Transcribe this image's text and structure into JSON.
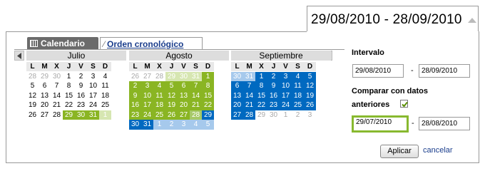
{
  "range_display": "29/08/2010 - 28/09/2010",
  "tabs": {
    "calendar": "Calendario",
    "chronological": "Orden cronológico"
  },
  "weekdays": [
    "L",
    "M",
    "X",
    "J",
    "V",
    "S",
    "D"
  ],
  "months": [
    {
      "name": "Julio",
      "weeks": [
        [
          [
            "28",
            "pale"
          ],
          [
            "29",
            "pale"
          ],
          [
            "30",
            "pale"
          ],
          [
            "1",
            "dflt"
          ],
          [
            "2",
            "dflt"
          ],
          [
            "3",
            "dflt"
          ],
          [
            "4",
            "dflt"
          ]
        ],
        [
          [
            "5",
            "dflt"
          ],
          [
            "6",
            "dflt"
          ],
          [
            "7",
            "dflt"
          ],
          [
            "8",
            "dflt"
          ],
          [
            "9",
            "dflt"
          ],
          [
            "10",
            "dflt"
          ],
          [
            "11",
            "dflt"
          ]
        ],
        [
          [
            "12",
            "dflt"
          ],
          [
            "13",
            "dflt"
          ],
          [
            "14",
            "dflt"
          ],
          [
            "15",
            "dflt"
          ],
          [
            "16",
            "dflt"
          ],
          [
            "17",
            "dflt"
          ],
          [
            "18",
            "dflt"
          ]
        ],
        [
          [
            "19",
            "dflt"
          ],
          [
            "20",
            "dflt"
          ],
          [
            "21",
            "dflt"
          ],
          [
            "22",
            "dflt"
          ],
          [
            "23",
            "dflt"
          ],
          [
            "24",
            "dflt"
          ],
          [
            "25",
            "dflt"
          ]
        ],
        [
          [
            "26",
            "dflt"
          ],
          [
            "27",
            "dflt"
          ],
          [
            "28",
            "dflt"
          ],
          [
            "29",
            "cmp"
          ],
          [
            "30",
            "cmp"
          ],
          [
            "31",
            "cmp"
          ],
          [
            "1",
            "cmplight"
          ]
        ]
      ]
    },
    {
      "name": "Agosto",
      "weeks": [
        [
          [
            "26",
            "pale"
          ],
          [
            "27",
            "pale"
          ],
          [
            "28",
            "pale"
          ],
          [
            "29",
            "cmplight"
          ],
          [
            "30",
            "cmplight"
          ],
          [
            "31",
            "cmplight"
          ],
          [
            "1",
            "cmp"
          ]
        ],
        [
          [
            "2",
            "cmp"
          ],
          [
            "3",
            "cmp"
          ],
          [
            "4",
            "cmp"
          ],
          [
            "5",
            "cmp"
          ],
          [
            "6",
            "cmp"
          ],
          [
            "7",
            "cmp"
          ],
          [
            "8",
            "cmp"
          ]
        ],
        [
          [
            "9",
            "cmp"
          ],
          [
            "10",
            "cmp"
          ],
          [
            "11",
            "cmp"
          ],
          [
            "12",
            "cmp"
          ],
          [
            "13",
            "cmp"
          ],
          [
            "14",
            "cmp"
          ],
          [
            "15",
            "cmp"
          ]
        ],
        [
          [
            "16",
            "cmp"
          ],
          [
            "17",
            "cmp"
          ],
          [
            "18",
            "cmp"
          ],
          [
            "19",
            "cmp"
          ],
          [
            "20",
            "cmp"
          ],
          [
            "21",
            "cmp"
          ],
          [
            "22",
            "cmp"
          ]
        ],
        [
          [
            "23",
            "cmp"
          ],
          [
            "24",
            "cmp"
          ],
          [
            "25",
            "cmp"
          ],
          [
            "26",
            "cmp"
          ],
          [
            "27",
            "cmp"
          ],
          [
            "28",
            "both"
          ],
          [
            "29",
            "cur"
          ]
        ],
        [
          [
            "30",
            "cur"
          ],
          [
            "31",
            "cur"
          ],
          [
            "1",
            "curlight"
          ],
          [
            "2",
            "curlight"
          ],
          [
            "3",
            "curlight"
          ],
          [
            "4",
            "curlight"
          ],
          [
            "5",
            "curlight"
          ]
        ]
      ]
    },
    {
      "name": "Septiembre",
      "weeks": [
        [
          [
            "30",
            "curlight"
          ],
          [
            "31",
            "curlight"
          ],
          [
            "1",
            "cur"
          ],
          [
            "2",
            "cur"
          ],
          [
            "3",
            "cur"
          ],
          [
            "4",
            "cur"
          ],
          [
            "5",
            "cur"
          ]
        ],
        [
          [
            "6",
            "cur"
          ],
          [
            "7",
            "cur"
          ],
          [
            "8",
            "cur"
          ],
          [
            "9",
            "cur"
          ],
          [
            "10",
            "cur"
          ],
          [
            "11",
            "cur"
          ],
          [
            "12",
            "cur"
          ]
        ],
        [
          [
            "13",
            "cur"
          ],
          [
            "14",
            "cur"
          ],
          [
            "15",
            "cur"
          ],
          [
            "16",
            "cur"
          ],
          [
            "17",
            "cur"
          ],
          [
            "18",
            "cur"
          ],
          [
            "19",
            "cur"
          ]
        ],
        [
          [
            "20",
            "cur"
          ],
          [
            "21",
            "cur"
          ],
          [
            "22",
            "cur"
          ],
          [
            "23",
            "cur"
          ],
          [
            "24",
            "cur"
          ],
          [
            "25",
            "cur"
          ],
          [
            "26",
            "cur"
          ]
        ],
        [
          [
            "27",
            "cur"
          ],
          [
            "28",
            "cur"
          ],
          [
            "29",
            "pale"
          ],
          [
            "30",
            "pale"
          ],
          [
            "1",
            "pale"
          ],
          [
            "2",
            "pale"
          ],
          [
            "3",
            "pale"
          ]
        ]
      ]
    }
  ],
  "side": {
    "interval_label": "Intervalo",
    "interval_start": "29/08/2010",
    "interval_end": "28/09/2010",
    "compare_label_1": "Comparar con datos",
    "compare_label_2": "anteriores",
    "compare_checked": true,
    "compare_start": "29/07/2010",
    "compare_end": "28/08/2010",
    "dash": "-",
    "apply": "Aplicar",
    "cancel": "cancelar"
  },
  "colors": {
    "current": "#0069c0",
    "compare": "#8ab523",
    "overlap": "#a7c969",
    "border_highlight": "#88b92f",
    "link": "#1a3d8c"
  },
  "icons": [
    "calendar-grid-icon",
    "chronological-chart-icon",
    "prev-arrow-icon",
    "next-arrow-icon",
    "dropdown-up-icon",
    "checkmark-icon"
  ]
}
